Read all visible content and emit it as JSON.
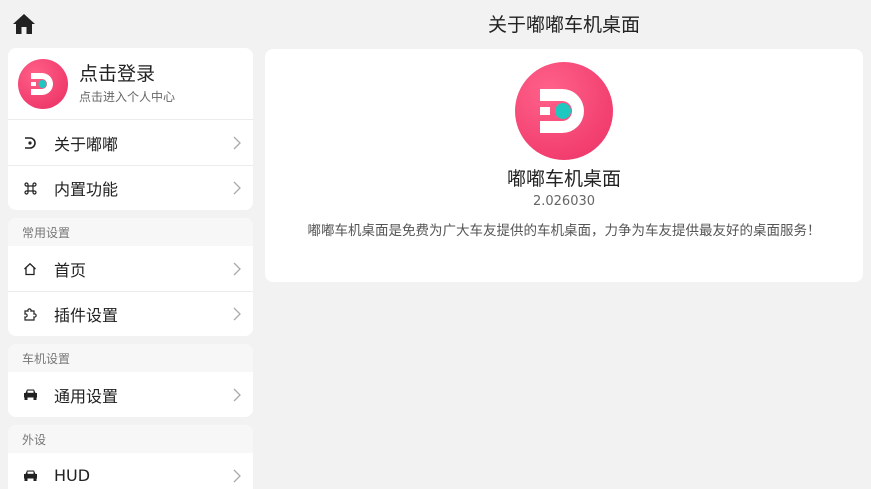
{
  "header": {
    "title": "关于嘟嘟车机桌面"
  },
  "login": {
    "title": "点击登录",
    "subtitle": "点击进入个人中心"
  },
  "menu_top": [
    {
      "label": "关于嘟嘟",
      "icon": "dudu-logo-icon"
    },
    {
      "label": "内置功能",
      "icon": "command-icon"
    }
  ],
  "sections": [
    {
      "title": "常用设置",
      "items": [
        {
          "label": "首页",
          "icon": "home-outline-icon"
        },
        {
          "label": "插件设置",
          "icon": "puzzle-icon"
        }
      ]
    },
    {
      "title": "车机设置",
      "items": [
        {
          "label": "通用设置",
          "icon": "car-icon"
        }
      ]
    },
    {
      "title": "外设",
      "items": [
        {
          "label": "HUD",
          "icon": "car-icon"
        }
      ]
    }
  ],
  "about": {
    "name": "嘟嘟车机桌面",
    "version": "2.026030",
    "description": "嘟嘟车机桌面是免费为广大车友提供的车机桌面，力争为车友提供最友好的桌面服务！"
  },
  "colors": {
    "brand_pink": "#f03c6d",
    "brand_teal": "#1fc7c1",
    "background": "#f2f2f2"
  }
}
